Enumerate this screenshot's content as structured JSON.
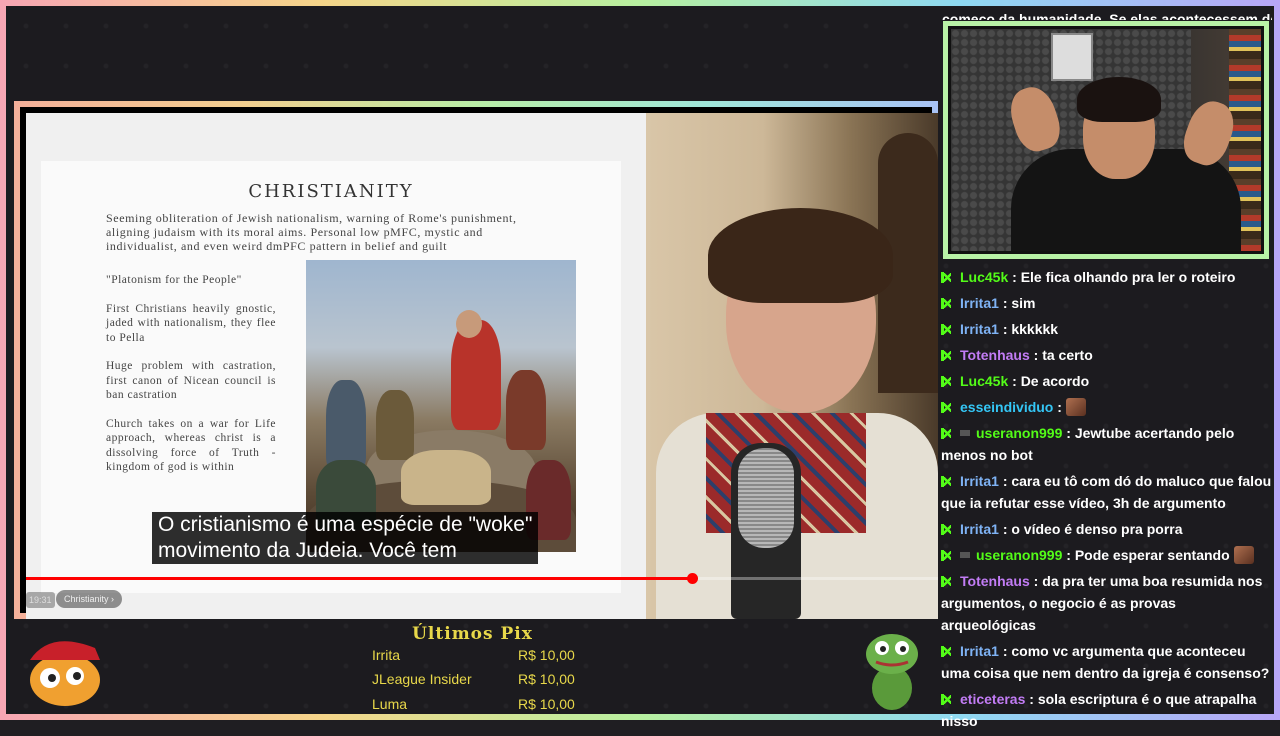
{
  "chat_overflow_text": "começo da humanidade. Se elas acontecessem de",
  "video": {
    "slide": {
      "title": "CHRISTIANITY",
      "intro": "Seeming obliteration of Jewish nationalism, warning of Rome's punishment, aligning judaism with its moral aims. Personal low pMFC, mystic and individualist, and even weird dmPFC pattern in belief and guilt",
      "points": [
        "\"Platonism for the People\"",
        "First Christians heavily gnostic, jaded with nationalism, they flee to Pella",
        "Huge problem with castration, first canon of Nicean council is ban castration",
        "Church takes on a war for Life approach, whereas christ is a dissolving force of Truth - kingdom of god is within"
      ]
    },
    "caption_line1": "O cristianismo é uma espécie de \"woke\"",
    "caption_line2": "movimento da Judeia. Você tem",
    "progress": 0.73,
    "time": "19:31",
    "chapter": "Christianity"
  },
  "chat": [
    {
      "user": "Luc45k",
      "color": "#53fc18",
      "text": ": Ele fica olhando pra ler o roteiro"
    },
    {
      "user": "Irrita1",
      "color": "#7fb3f5",
      "text": ": sim"
    },
    {
      "user": "Irrita1",
      "color": "#7fb3f5",
      "text": ": kkkkkk"
    },
    {
      "user": "Totenhaus",
      "color": "#c27cf5",
      "text": ": ta certo"
    },
    {
      "user": "Luc45k",
      "color": "#53fc18",
      "text": ": De acordo"
    },
    {
      "user": "esseindividuo",
      "color": "#34c6f5",
      "text": ":"
    },
    {
      "user": "useranon999",
      "color": "#53fc18",
      "text": ": Jewtube acertando pelo menos no bot"
    },
    {
      "user": "Irrita1",
      "color": "#7fb3f5",
      "text": ": cara eu tô com dó do maluco que falou que ia refutar esse vídeo, 3h de argumento"
    },
    {
      "user": "Irrita1",
      "color": "#7fb3f5",
      "text": ": o vídeo é denso pra porra"
    },
    {
      "user": "useranon999",
      "color": "#53fc18",
      "text": ": Pode esperar sentando"
    },
    {
      "user": "Totenhaus",
      "color": "#c27cf5",
      "text": ": da pra ter uma boa resumida nos argumentos, o negocio é as provas arqueológicas"
    },
    {
      "user": "Irrita1",
      "color": "#7fb3f5",
      "text": ": como vc argumenta que aconteceu uma coisa que nem dentro da igreja é consenso?"
    },
    {
      "user": "eticeteras",
      "color": "#c27cf5",
      "text": ": sola escriptura é o que atrapalha nisso"
    }
  ],
  "pix": {
    "title": "Últimos Pix",
    "entries": [
      {
        "name": "Irrita",
        "value": "R$ 10,00"
      },
      {
        "name": "JLeague Insider",
        "value": "R$ 10,00"
      },
      {
        "name": "Luma",
        "value": "R$ 10,00"
      }
    ]
  }
}
